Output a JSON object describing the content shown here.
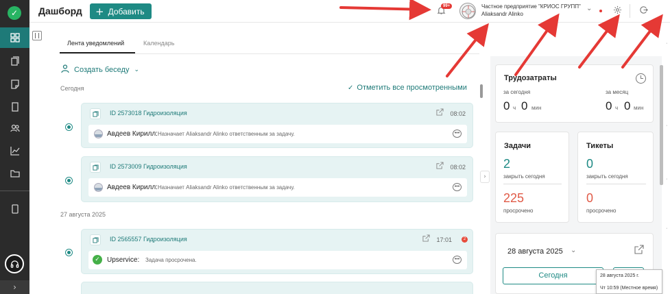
{
  "header": {
    "title": "Дашборд",
    "add_button": "Добавить",
    "notifications_badge": "99+",
    "org_name": "Частное предприятие \"КРИОС ГРУПП\"",
    "user_name": "Aliaksandr Alinko"
  },
  "tabs": [
    {
      "label": "Лента уведомлений",
      "active": true
    },
    {
      "label": "Календарь",
      "active": false
    }
  ],
  "feed": {
    "create_chat": "Создать беседу",
    "mark_all_read": "Отметить все просмотренными",
    "groups": [
      {
        "date": "Сегодня",
        "items": [
          {
            "title": "ID 2573018 Гидроизоляция",
            "time": "08:02",
            "author": "Авдеев Кирилл:",
            "text": "Назначает Aliaksandr Alinko ответственным за задачу."
          },
          {
            "title": "ID 2573009 Гидроизоляция",
            "time": "08:02",
            "author": "Авдеев Кирилл:",
            "text": "Назначает Aliaksandr Alinko ответственным за задачу."
          }
        ]
      },
      {
        "date": "27 августа 2025",
        "items": [
          {
            "title": "ID 2565557 Гидроизоляция",
            "time": "17:01",
            "badge": "2",
            "author": "Upservice:",
            "text": "Задача просрочена."
          }
        ]
      }
    ]
  },
  "labor": {
    "title": "Трудозатраты",
    "today_label": "за сегодня",
    "month_label": "за месяц",
    "today_hours": "0",
    "today_minutes": "0",
    "month_hours": "0",
    "month_minutes": "0",
    "hours_unit": "ч",
    "minutes_unit": "мин"
  },
  "tasks": {
    "title": "Задачи",
    "close_today_value": "2",
    "close_today_label": "закрыть сегодня",
    "overdue_value": "225",
    "overdue_label": "просрочено"
  },
  "tickets": {
    "title": "Тикеты",
    "close_today_value": "0",
    "close_today_label": "закрыть сегодня",
    "overdue_value": "0",
    "overdue_label": "просрочено"
  },
  "calendar": {
    "date": "28 августа 2025",
    "today_button": "Сегодня"
  },
  "tooltip": {
    "line1": "28 августа 2025 г.",
    "line2": "Чт 10:59 (Местное время)"
  },
  "colors": {
    "accent": "#1e8a84",
    "alert": "#e05a47",
    "annotation_arrow": "#e53935"
  }
}
